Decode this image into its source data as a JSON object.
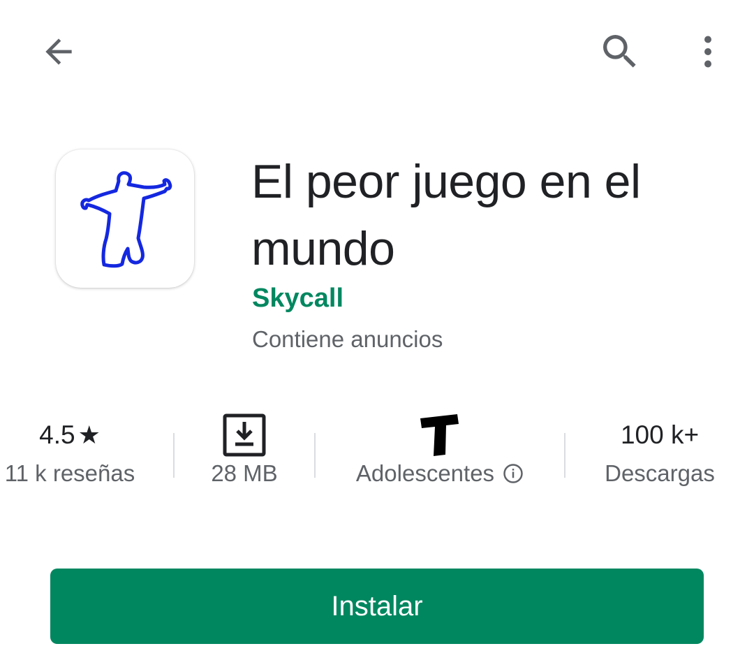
{
  "top_bar": {
    "back_icon": "arrow-back-icon",
    "search_icon": "search-icon",
    "more_icon": "more-vert-icon"
  },
  "app": {
    "title": "El peor juego en el mundo",
    "developer": "Skycall",
    "ads_note": "Contiene anuncios",
    "icon": "stick-figure-icon"
  },
  "stats": {
    "rating": {
      "value": "4.5",
      "star": "★",
      "reviews": "11 k reseñas"
    },
    "size": {
      "icon": "download-icon",
      "label": "28 MB"
    },
    "content_rating": {
      "icon": "teen-rating-icon",
      "label": "Adolescentes",
      "info_icon": "info-icon"
    },
    "downloads": {
      "value": "100 k+",
      "label": "Descargas"
    }
  },
  "install_button": {
    "label": "Instalar"
  },
  "colors": {
    "accent_green": "#01875f",
    "text_primary": "#202124",
    "text_secondary": "#5f6368",
    "icon_figure_blue": "#1428e0"
  }
}
